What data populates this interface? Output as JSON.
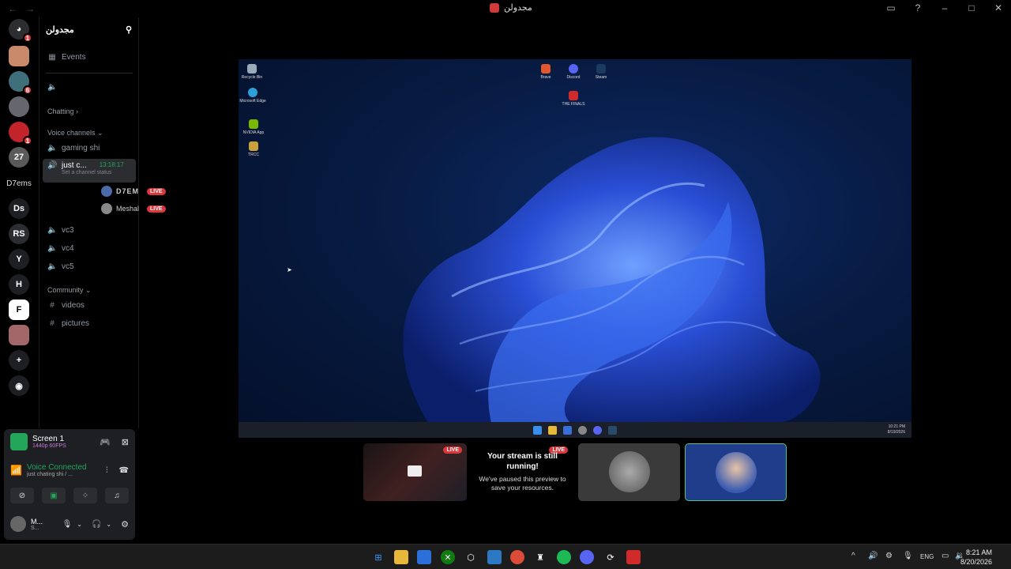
{
  "window": {
    "title": "مجدولن"
  },
  "server": {
    "name": "مجدولن"
  },
  "guilds": {
    "badges": [
      "1",
      "6",
      "1"
    ],
    "texts": [
      "D7ems",
      "Ds",
      "RS",
      "H"
    ]
  },
  "channels": {
    "events": "Events",
    "cat_chatting": "Chatting",
    "cat_voice": "Voice channels",
    "gaming": "gaming shi",
    "active_name": "just c...",
    "active_timer": "13:18:17",
    "active_status": "Set a channel status",
    "vc3": "vc3",
    "vc4": "vc4",
    "vc5": "vc5",
    "cat_community": "Community",
    "videos": "videos",
    "pictures": "pictures"
  },
  "voice_users": [
    {
      "name": "D7EM",
      "badge": "LIVE"
    },
    {
      "name": "Meshal",
      "badge": "LIVE"
    }
  ],
  "panel": {
    "screen_title": "Screen 1",
    "screen_sub": "1440p 60FPS",
    "voice_title": "Voice Connected",
    "voice_sub": "just chating shi / ...",
    "user_name": "M...",
    "user_status": "S..."
  },
  "desktop_icons": [
    "Recycle Bin",
    "Microsoft Edge",
    "NVIDIA App",
    "TRCC",
    "Brave",
    "Discord",
    "Steam",
    "THE FINALS"
  ],
  "stream_clock": {
    "time": "10:21 PM",
    "date": "8/19/2026"
  },
  "tiles": {
    "live": "LIVE",
    "paused_title": "Your stream is still running!",
    "paused_body": "We've paused this preview to save your resources."
  },
  "taskbar": {
    "lang": "ENG",
    "time": "8:21 AM",
    "date": "8/20/2026"
  },
  "colors": {
    "accent": "#2a4fd6",
    "live": "#da373c",
    "green": "#23a55a"
  }
}
